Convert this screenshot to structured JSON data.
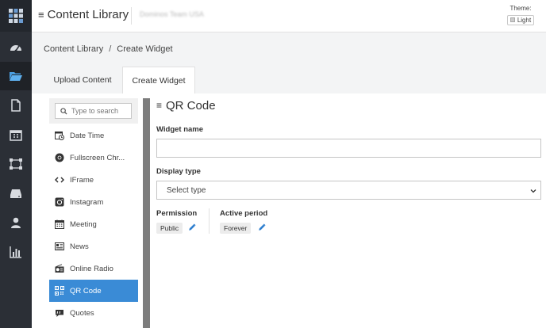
{
  "app": {
    "title": "Content Library",
    "org_name": "Dominos Team USA"
  },
  "theme": {
    "label": "Theme:",
    "value": "Light"
  },
  "breadcrumb": {
    "root": "Content Library",
    "separator": "/",
    "current": "Create Widget"
  },
  "tabs": [
    {
      "label": "Upload Content"
    },
    {
      "label": "Create Widget"
    }
  ],
  "search": {
    "placeholder": "Type to search"
  },
  "widgets": [
    {
      "label": "Date Time",
      "icon": "calendar-clock-icon"
    },
    {
      "label": "Fullscreen Chr...",
      "icon": "chrome-icon"
    },
    {
      "label": "IFrame",
      "icon": "code-icon"
    },
    {
      "label": "Instagram",
      "icon": "instagram-icon"
    },
    {
      "label": "Meeting",
      "icon": "calendar-icon"
    },
    {
      "label": "News",
      "icon": "newspaper-icon"
    },
    {
      "label": "Online Radio",
      "icon": "radio-icon"
    },
    {
      "label": "QR Code",
      "icon": "qrcode-icon"
    },
    {
      "label": "Quotes",
      "icon": "quote-icon"
    }
  ],
  "selected_widget": "QR Code",
  "form": {
    "title": "QR Code",
    "widget_name_label": "Widget name",
    "widget_name_value": "",
    "display_type_label": "Display type",
    "display_type_value": "Select type",
    "permission_label": "Permission",
    "permission_value": "Public",
    "active_period_label": "Active period",
    "active_period_value": "Forever"
  },
  "colors": {
    "accent": "#3a8bd6",
    "rail": "#2b2f36",
    "edit_icon": "#2f7fcf"
  }
}
